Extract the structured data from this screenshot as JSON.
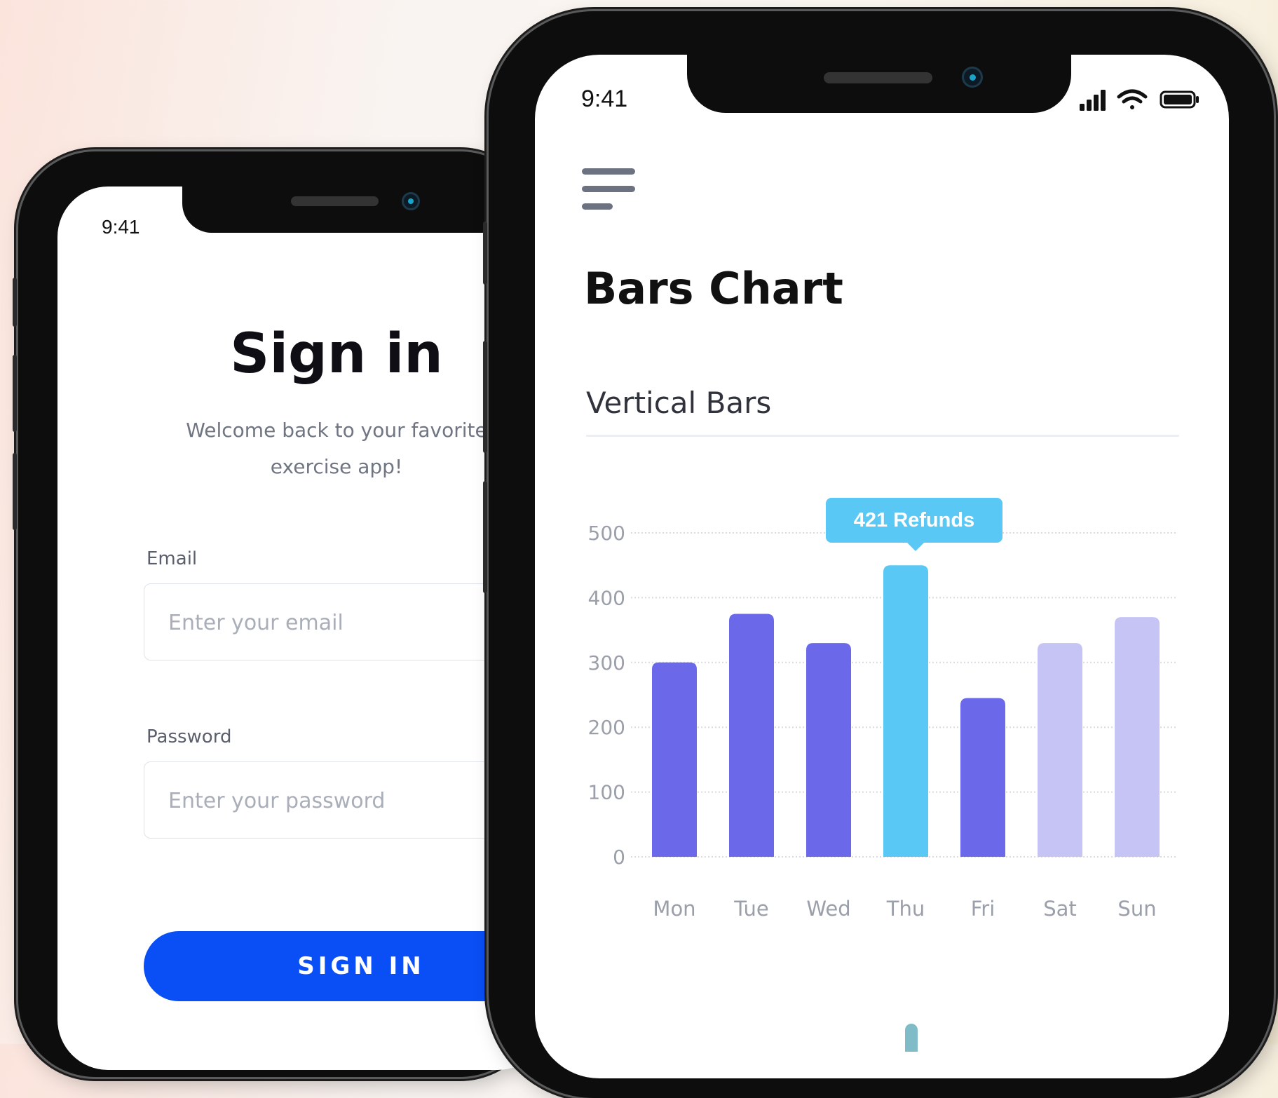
{
  "signin_screen": {
    "status_time": "9:41",
    "title": "Sign in",
    "welcome_line1": "Welcome back to your favorite",
    "welcome_line2": "exercise app!",
    "email_label": "Email",
    "email_placeholder": "Enter your email",
    "password_label": "Password",
    "password_placeholder": "Enter your password",
    "signin_button": "SIGN IN"
  },
  "chart_screen": {
    "status_time": "9:41",
    "title": "Bars Chart",
    "section_title": "Vertical Bars",
    "tooltip": "421 Refunds"
  },
  "colors": {
    "bar_primary": "#6b69ea",
    "bar_highlight": "#5ac8f5",
    "bar_faded": "#c6c3f5",
    "button_blue": "#0a4ef5"
  },
  "chart_data": {
    "type": "bar",
    "categories": [
      "Mon",
      "Tue",
      "Wed",
      "Thu",
      "Fri",
      "Sat",
      "Sun"
    ],
    "values": [
      300,
      375,
      330,
      450,
      245,
      330,
      370
    ],
    "highlighted": "Thu",
    "faded": [
      "Sat",
      "Sun"
    ],
    "yticks": [
      0,
      100,
      200,
      300,
      400,
      500
    ],
    "ylim": [
      0,
      500
    ],
    "grid": true,
    "legend": "none"
  }
}
